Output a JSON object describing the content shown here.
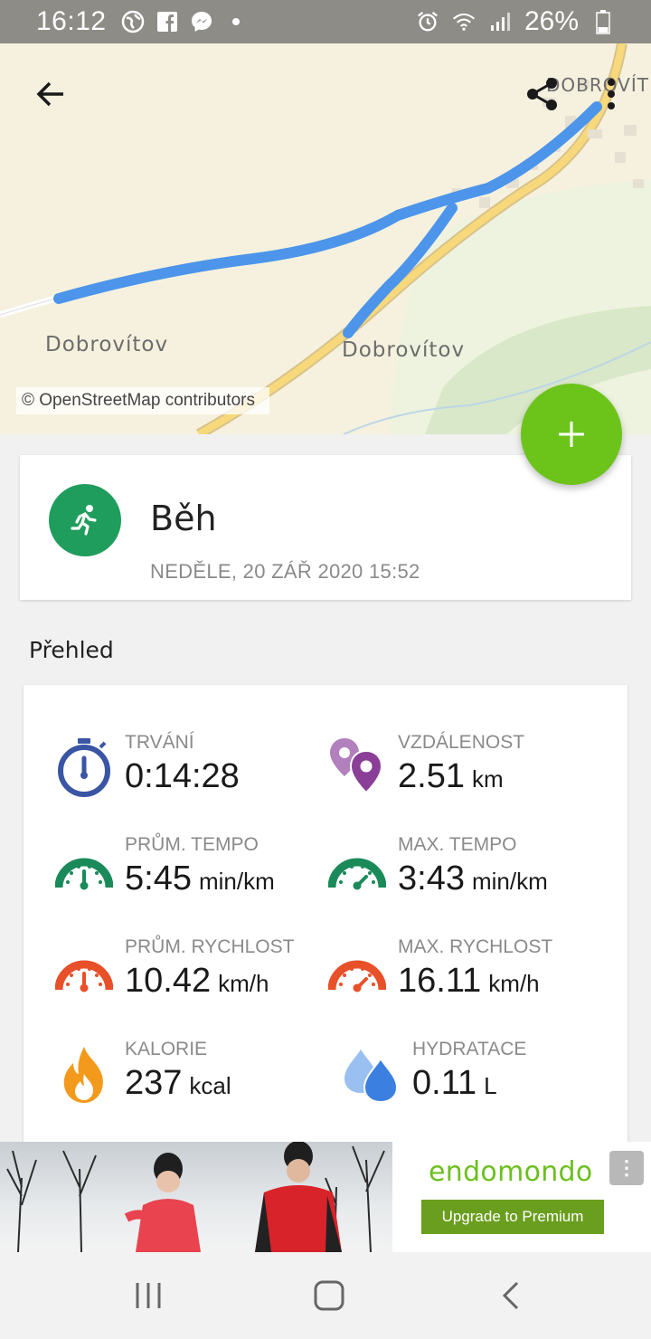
{
  "status_bar": {
    "time": "16:12",
    "battery": "26%",
    "notification_icons": [
      "globe-icon",
      "facebook-icon",
      "messenger-icon",
      "dot-icon"
    ],
    "system_icons": [
      "alarm-icon",
      "wifi-icon",
      "signal-icon",
      "battery-icon"
    ]
  },
  "map": {
    "labels": [
      "Dobrovítov",
      "Dobrovítov",
      "DOBROVÍT"
    ],
    "attribution": "© OpenStreetMap contributors",
    "route_color": "#4c95ea"
  },
  "toolbar": {
    "back_icon": "arrow-left-icon",
    "share_icon": "share-icon",
    "more_icon": "more-vert-icon"
  },
  "fab": {
    "icon": "plus-icon",
    "color": "#6cc41b"
  },
  "activity": {
    "sport": "Běh",
    "date": "NEDĚLE, 20 ZÁŘ 2020 15:52",
    "icon": "running-icon",
    "color": "#1f9d5c"
  },
  "overview": {
    "title": "Přehled",
    "stats": [
      {
        "label": "TRVÁNÍ",
        "value": "0:14:28",
        "unit": "",
        "icon": "stopwatch-icon",
        "color": "#3a55a4"
      },
      {
        "label": "VZDÁLENOST",
        "value": "2.51",
        "unit": "km",
        "icon": "location-pin-icon",
        "color": "#8a3e97"
      },
      {
        "label": "PRŮM. TEMPO",
        "value": "5:45",
        "unit": "min/km",
        "icon": "speedometer-icon",
        "color": "#1a8a5a"
      },
      {
        "label": "MAX. TEMPO",
        "value": "3:43",
        "unit": "min/km",
        "icon": "speedometer-icon",
        "color": "#1a8a5a"
      },
      {
        "label": "PRŮM. RYCHLOST",
        "value": "10.42",
        "unit": "km/h",
        "icon": "speedometer-icon",
        "color": "#e8502a"
      },
      {
        "label": "MAX. RYCHLOST",
        "value": "16.11",
        "unit": "km/h",
        "icon": "speedometer-icon",
        "color": "#e8502a"
      },
      {
        "label": "KALORIE",
        "value": "237",
        "unit": "kcal",
        "icon": "flame-icon",
        "color": "#f39a1c"
      },
      {
        "label": "HYDRATACE",
        "value": "0.11",
        "unit": "L",
        "icon": "water-drops-icon",
        "color": "#3b7fe0"
      }
    ]
  },
  "ad": {
    "brand": "endomondo",
    "button": "Upgrade to Premium",
    "brand_color": "#6cbf1d"
  },
  "nav_bar": {
    "recents_icon": "recents-icon",
    "home_icon": "home-icon",
    "back_icon": "back-chevron-icon"
  }
}
